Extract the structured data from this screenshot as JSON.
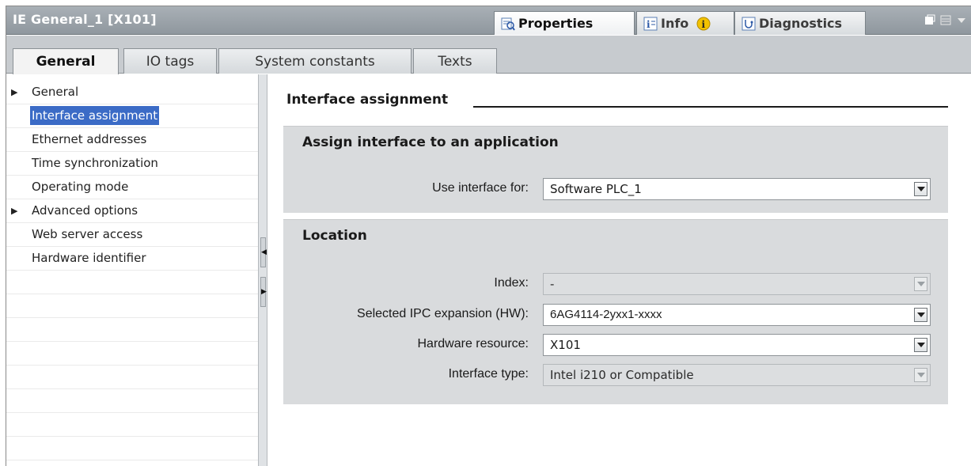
{
  "window": {
    "title": "IE General_1 [X101]",
    "tabs_top": [
      {
        "label": "Properties",
        "icon": "properties-icon"
      },
      {
        "label": "Info",
        "icon": "info-icon"
      },
      {
        "label": "Diagnostics",
        "icon": "diagnostics-icon"
      }
    ]
  },
  "tabs": [
    {
      "label": "General"
    },
    {
      "label": "IO tags"
    },
    {
      "label": "System constants"
    },
    {
      "label": "Texts"
    }
  ],
  "sidebar": {
    "items": [
      {
        "label": "General",
        "expandable": true
      },
      {
        "label": "Interface assignment",
        "selected": true
      },
      {
        "label": "Ethernet addresses"
      },
      {
        "label": "Time synchronization"
      },
      {
        "label": "Operating mode"
      },
      {
        "label": "Advanced options",
        "expandable": true
      },
      {
        "label": "Web server access"
      },
      {
        "label": "Hardware identifier"
      }
    ]
  },
  "main": {
    "section_title": "Interface assignment",
    "groups": [
      {
        "title": "Assign interface to an application",
        "fields": [
          {
            "label": "Use interface for:",
            "value": "Software PLC_1",
            "enabled": true
          }
        ]
      },
      {
        "title": "Location",
        "fields": [
          {
            "label": "Index:",
            "value": "-",
            "enabled": false
          },
          {
            "label": "Selected IPC expansion (HW):",
            "value": "6AG4114-2yxx1-xxxx",
            "enabled": true
          },
          {
            "label": "Hardware resource:",
            "value": "X101",
            "enabled": true
          },
          {
            "label": "Interface type:",
            "value": "Intel i210 or Compatible",
            "enabled": false
          }
        ]
      }
    ]
  },
  "colors": {
    "selection": "#3b6bc6",
    "titlebar": "#9aa2a8",
    "group_bg": "#d9dbdd"
  }
}
